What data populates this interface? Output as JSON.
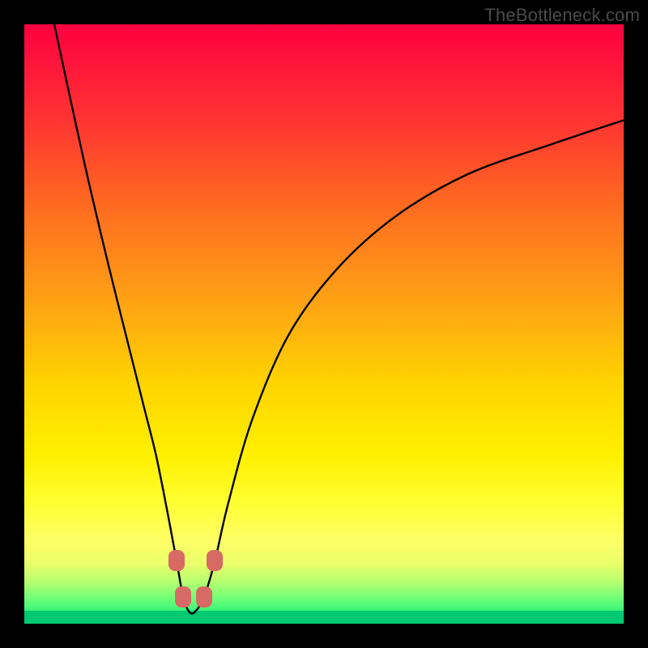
{
  "watermark": "TheBottleneck.com",
  "colors": {
    "background": "#000000",
    "curve_stroke": "#000000",
    "marker_fill": "#d86a66",
    "gradient_top": "#ff0040",
    "gradient_bottom": "#00e57a"
  },
  "chart_data": {
    "type": "line",
    "title": "",
    "xlabel": "",
    "ylabel": "",
    "xlim": [
      0,
      100
    ],
    "ylim": [
      0,
      100
    ],
    "x": [
      5,
      10,
      14,
      18,
      20,
      22,
      24,
      25.4,
      26.5,
      27.5,
      28.5,
      30,
      31.8,
      34,
      38,
      44,
      52,
      62,
      74,
      88,
      100
    ],
    "y": [
      100,
      77,
      60,
      44,
      36,
      28,
      18,
      10.5,
      4.5,
      2,
      2,
      4.5,
      10.5,
      20,
      34,
      48,
      59,
      68,
      75,
      80,
      84
    ],
    "markers": [
      {
        "x": 25.4,
        "y": 10.5
      },
      {
        "x": 31.8,
        "y": 10.5
      },
      {
        "x": 26.5,
        "y": 4.5
      },
      {
        "x": 30.0,
        "y": 4.5
      }
    ],
    "notes": "V-shaped bottleneck curve on a red-to-green vertical gradient. Minimum (green/optimal zone) around x≈27–30. Axis values are relative (0–100) as no tick labels are shown."
  }
}
